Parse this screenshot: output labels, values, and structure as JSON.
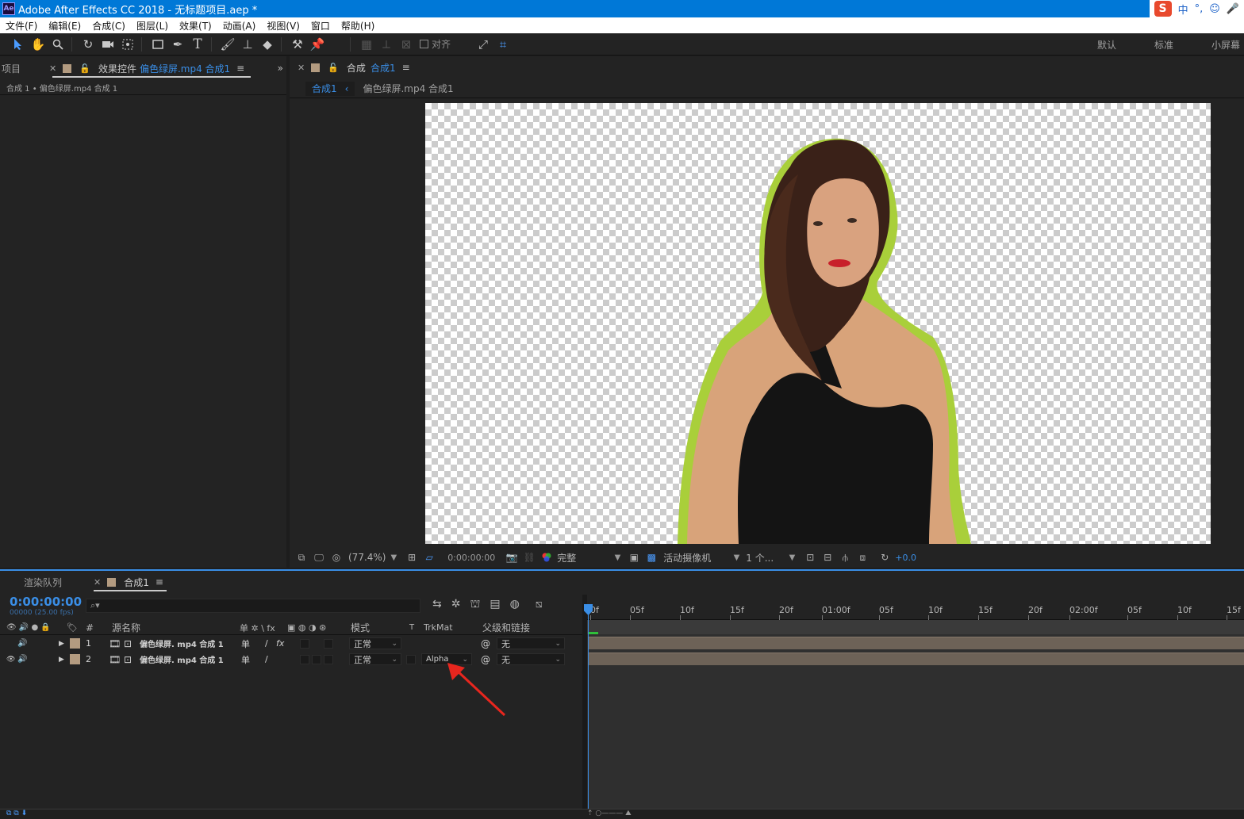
{
  "app": {
    "title": "Adobe After Effects CC 2018 - 无标题项目.aep *",
    "logo": "Ae"
  },
  "ime": {
    "logo": "S",
    "lang": "中",
    "punct": "°,",
    "emoji": "☺",
    "mic": "🎤"
  },
  "menu": [
    "文件(F)",
    "编辑(E)",
    "合成(C)",
    "图层(L)",
    "效果(T)",
    "动画(A)",
    "视图(V)",
    "窗口",
    "帮助(H)"
  ],
  "toolbar": {
    "align_label": "对齐",
    "workspaces": [
      "默认",
      "标准",
      "小屏幕"
    ]
  },
  "left_panel": {
    "project_tab": "项目",
    "effects_tab_prefix": "效果控件",
    "effects_tab_layer": "偏色绿屏.mp4 合成1",
    "breadcrumb": "合成 1 • 偏色绿屏.mp4 合成 1"
  },
  "viewer": {
    "tab_prefix": "合成",
    "tab_name": "合成1",
    "crumb_active": "合成1",
    "crumb_other": "偏色绿屏.mp4 合成1",
    "zoom": "(77.4%)",
    "timecode": "0:00:00:00",
    "resolution": "完整",
    "camera": "活动摄像机",
    "views": "1 个...",
    "exposure": "+0.0"
  },
  "timeline": {
    "render_queue_tab": "渲染队列",
    "comp_tab": "合成1",
    "timecode": "0:00:00:00",
    "fps": "00000 (25.00 fps)",
    "search_placeholder": "⌕▾",
    "headers": {
      "hash": "#",
      "source_name": "源名称",
      "switches": "单 ✲ \\ fx",
      "mode": "模式",
      "t": "T",
      "trkmat": "TrkMat",
      "parent": "父级和链接"
    },
    "layers": [
      {
        "num": "1",
        "name": "偏色绿屏. mp4 合成 1",
        "mode": "正常",
        "trkmat": "",
        "parent": "无"
      },
      {
        "num": "2",
        "name": "偏色绿屏. mp4 合成 1",
        "mode": "正常",
        "trkmat": "Alpha",
        "parent": "无"
      }
    ],
    "ruler": [
      "0f",
      "05f",
      "10f",
      "15f",
      "20f",
      "01:00f",
      "05f",
      "10f",
      "15f",
      "20f",
      "02:00f",
      "05f",
      "10f",
      "15f"
    ]
  }
}
